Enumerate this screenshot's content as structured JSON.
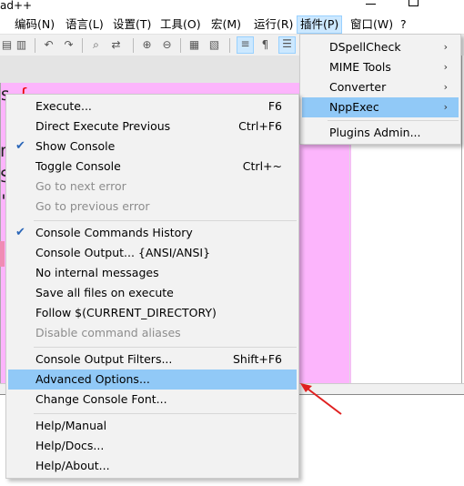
{
  "window": {
    "title_fragment": "ad++"
  },
  "menubar": {
    "items": [
      {
        "label": "编码(N)"
      },
      {
        "label": "语言(L)"
      },
      {
        "label": "设置(T)"
      },
      {
        "label": "工具(O)"
      },
      {
        "label": "宏(M)"
      },
      {
        "label": "运行(R)"
      },
      {
        "label": "插件(P)",
        "active": true
      },
      {
        "label": "窗口(W)"
      },
      {
        "label": "?"
      }
    ]
  },
  "editor": {
    "fragments": [
      "s",
      "{",
      "n",
      "S",
      "\""
    ]
  },
  "plugins_menu": {
    "items": [
      {
        "label": "DSpellCheck",
        "submenu": true
      },
      {
        "label": "MIME Tools",
        "submenu": true
      },
      {
        "label": "Converter",
        "submenu": true
      },
      {
        "label": "NppExec",
        "submenu": true,
        "highlighted": true
      },
      {
        "label": "Plugins Admin..."
      }
    ]
  },
  "nppexec_menu": {
    "groups": [
      [
        {
          "label": "Execute...",
          "shortcut": "F6"
        },
        {
          "label": "Direct Execute Previous",
          "shortcut": "Ctrl+F6"
        },
        {
          "label": "Show Console",
          "checked": true
        },
        {
          "label": "Toggle Console",
          "shortcut": "Ctrl+~"
        },
        {
          "label": "Go to next error",
          "disabled": true
        },
        {
          "label": "Go to previous error",
          "disabled": true
        }
      ],
      [
        {
          "label": "Console Commands History",
          "checked": true
        },
        {
          "label": "Console Output... {ANSI/ANSI}"
        },
        {
          "label": "No internal messages"
        },
        {
          "label": "Save all files on execute"
        },
        {
          "label": "Follow $(CURRENT_DIRECTORY)"
        },
        {
          "label": "Disable command aliases",
          "disabled": true
        }
      ],
      [
        {
          "label": "Console Output Filters...",
          "shortcut": "Shift+F6"
        },
        {
          "label": "Advanced Options...",
          "highlighted": true
        },
        {
          "label": "Change Console Font..."
        }
      ],
      [
        {
          "label": "Help/Manual"
        },
        {
          "label": "Help/Docs..."
        },
        {
          "label": "Help/About..."
        }
      ]
    ]
  },
  "annotation": {
    "arrow_color": "#e02020"
  }
}
